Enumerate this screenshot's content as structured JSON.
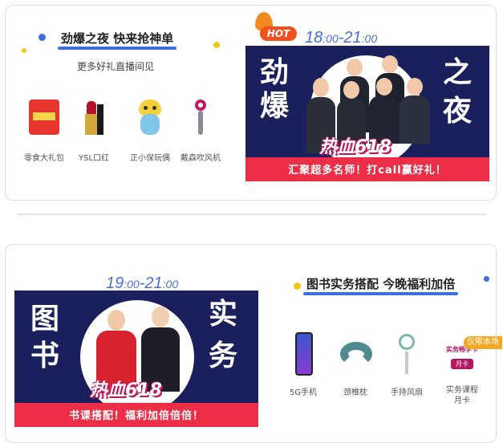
{
  "card1": {
    "title": "劲爆之夜 快来抢神单",
    "subtitle": "更多好礼直播间见",
    "gifts": [
      {
        "label": "零食大礼包",
        "icon": "snack-bag-icon"
      },
      {
        "label": "YSL口红",
        "icon": "lipstick-icon"
      },
      {
        "label": "正小保玩偶",
        "icon": "plush-toy-icon"
      },
      {
        "label": "戴森吹风机",
        "icon": "hair-dryer-icon"
      }
    ],
    "banner": {
      "hot_badge": "HOT",
      "time_start": "18",
      "time_start_min": ":00",
      "time_sep": "-",
      "time_end": "21",
      "time_end_min": ":00",
      "left_chars": [
        "劲",
        "爆"
      ],
      "right_chars": [
        "之",
        "夜"
      ],
      "event_name": "热血618",
      "slogan": "汇聚超多名师！打call赢好礼！"
    }
  },
  "card2": {
    "title": "图书实务搭配 今晚福利加倍",
    "gifts": [
      {
        "label": "5G手机",
        "icon": "phone-icon"
      },
      {
        "label": "颈椎枕",
        "icon": "neck-pillow-icon"
      },
      {
        "label": "手持风扇",
        "icon": "hand-fan-icon"
      },
      {
        "label": "实务课程\n月卡",
        "icon": "course-card-icon"
      }
    ],
    "limited_tag": "仅限本场",
    "course_card_text": "实务畅学卡",
    "course_card_sub": "月卡",
    "banner": {
      "time_start": "19",
      "time_start_min": ":00",
      "time_sep": "-",
      "time_end": "21",
      "time_end_min": ":00",
      "left_chars": [
        "图",
        "书"
      ],
      "right_chars": [
        "实",
        "务"
      ],
      "event_name": "热血618",
      "slogan": "书课搭配！福利加倍倍倍！"
    }
  },
  "colors": {
    "navy": "#19205c",
    "red": "#ec2f47",
    "accent_blue": "#3d6fe0",
    "time_blue": "#4a6ee0"
  }
}
